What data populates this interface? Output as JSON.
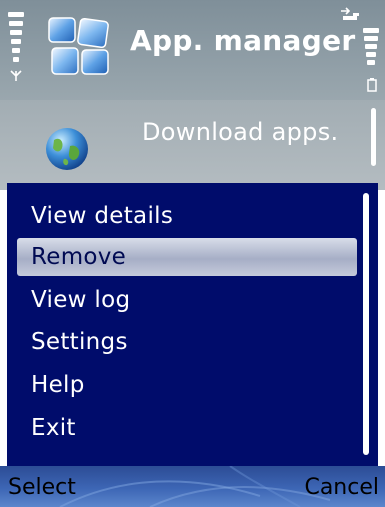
{
  "title_pane": {
    "title": "App. manager",
    "app_icon": "app-manager-icon"
  },
  "status_indicators": {
    "signal_icon": "antenna-icon",
    "battery_icon": "battery-icon",
    "data_icon": "data-transfer-icon"
  },
  "main_list": {
    "items": [
      {
        "label": "Download apps.",
        "icon": "globe-icon"
      }
    ]
  },
  "options_menu": {
    "items": [
      {
        "label": "View details",
        "selected": false
      },
      {
        "label": "Remove",
        "selected": true
      },
      {
        "label": "View log",
        "selected": false
      },
      {
        "label": "Settings",
        "selected": false
      },
      {
        "label": "Help",
        "selected": false
      },
      {
        "label": "Exit",
        "selected": false
      }
    ]
  },
  "softkeys": {
    "left": "Select",
    "right": "Cancel"
  },
  "colors": {
    "menu_background": "#000c6b",
    "highlight": "#b6bdd2",
    "softkey_bar": "#3d66b5"
  }
}
